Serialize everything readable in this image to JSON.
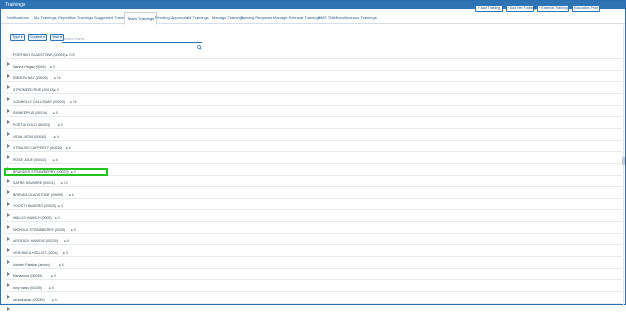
{
  "window": {
    "title": "Trainings"
  },
  "nav": {
    "tabs": [
      {
        "label": "Notifications"
      },
      {
        "label": "My Trainings"
      },
      {
        "label": "Repetitive Trainings"
      },
      {
        "label": "Suggested Trainings"
      },
      {
        "label": "Team Trainings"
      },
      {
        "label": "Pending Approvals"
      },
      {
        "label": "All Trainings"
      },
      {
        "label": "Manage Trainings"
      },
      {
        "label": "Training Requests"
      },
      {
        "label": "Manage External Trainings"
      },
      {
        "label": "PMS TNI"
      },
      {
        "label": "Miscellaneous Trainings"
      }
    ],
    "active_tab": "Team Trainings"
  },
  "actions": {
    "add_training": "+ Add Training",
    "add_her_training": "+ Add Her Training",
    "external_training": "+ External Training",
    "education_prior": "Education Prior"
  },
  "filters": {
    "type": "Type ▾",
    "context": "Context ▾",
    "year": "Year ▾",
    "search_placeholder": "Search Name..."
  },
  "employees": [
    {
      "name": "PORFIDIO GLADSTONE (00024)",
      "count": "105"
    },
    {
      "name": "Nanna Hegan (0004)",
      "count": "9"
    },
    {
      "name": "EMISON NAY (00026)",
      "count": "15"
    },
    {
      "name": "STROMEED RUE (00012)",
      "count": "9"
    },
    {
      "name": "CONNOLLY CALLOWAY (00020)",
      "count": "16"
    },
    {
      "name": "RAINEEPIUS (00016)",
      "count": "8"
    },
    {
      "name": "PORTIA GOLD (A0003)",
      "count": "8"
    },
    {
      "name": "VIDAL VEDA (00040)",
      "count": "6"
    },
    {
      "name": "STRAUSS CAFFERTY (A0040)",
      "count": "6"
    },
    {
      "name": "ROSE JUDE (00042)",
      "count": "6"
    },
    {
      "name": "BRANDER STRAWBERRY (00023)",
      "count": "4"
    },
    {
      "name": "SAFRE HAVARRE (00011)",
      "count": "15"
    },
    {
      "name": "BRENDA GLADSTONE (09999)",
      "count": "6"
    },
    {
      "name": "YOOST HAVARRO (00025)",
      "count": "4"
    },
    {
      "name": "WALLIS HAMICH (0005)",
      "count": "4"
    },
    {
      "name": "NICHOLE STRAWBERRY (0035)",
      "count": "6"
    },
    {
      "name": "ARCIDICK HANIDIS (00230)",
      "count": "6"
    },
    {
      "name": "VERONICA HOLLIST (0024)",
      "count": "5"
    },
    {
      "name": "Ashwin Patakar (anwin)",
      "count": "6"
    },
    {
      "name": "Rahamura (00049)",
      "count": "5"
    },
    {
      "name": "tony mass (00245)",
      "count": "6"
    },
    {
      "name": "ravindrapan (00249)",
      "count": "5"
    }
  ],
  "highlighted_employee": "BRANDER STRAWBERRY (00023)"
}
